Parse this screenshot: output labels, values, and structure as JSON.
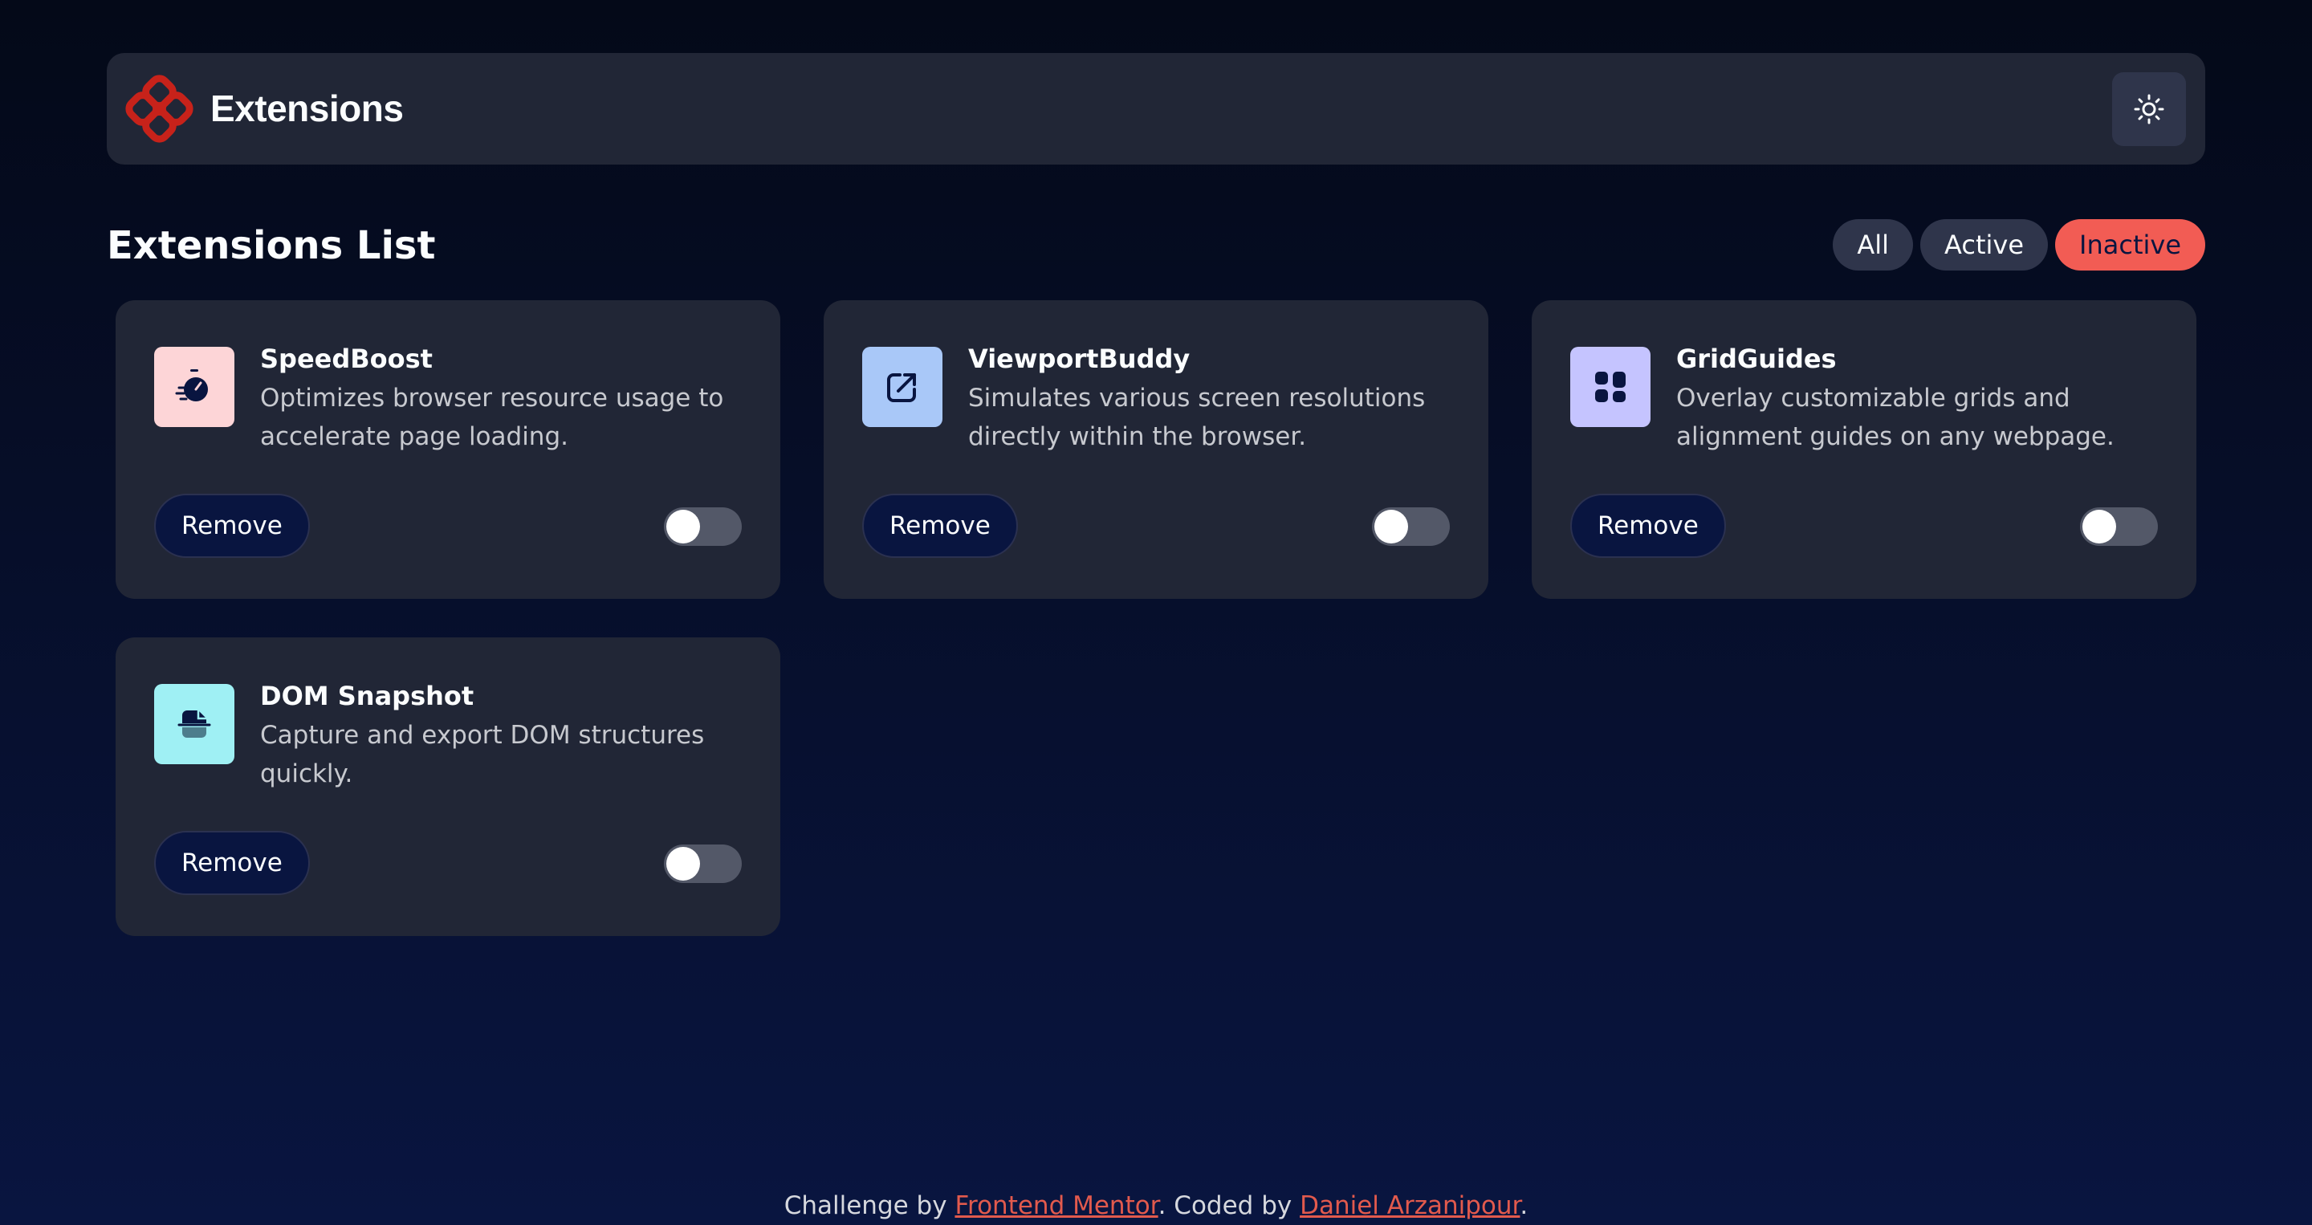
{
  "header": {
    "title": "Extensions",
    "logo_icon": "logo-icon",
    "theme_toggle_icon": "sun-icon"
  },
  "list": {
    "title": "Extensions List",
    "filters": [
      {
        "label": "All",
        "selected": false
      },
      {
        "label": "Active",
        "selected": false
      },
      {
        "label": "Inactive",
        "selected": true
      }
    ]
  },
  "extensions": [
    {
      "name": "SpeedBoost",
      "description": "Optimizes browser resource usage to accelerate page loading.",
      "remove_label": "Remove",
      "active": false,
      "icon": "stopwatch-icon",
      "icon_bg": "#fdd5d7"
    },
    {
      "name": "ViewportBuddy",
      "description": "Simulates various screen resolutions directly within the browser.",
      "remove_label": "Remove",
      "active": false,
      "icon": "external-link-icon",
      "icon_bg": "#a9c8f8"
    },
    {
      "name": "GridGuides",
      "description": "Overlay customizable grids and alignment guides on any webpage.",
      "remove_label": "Remove",
      "active": false,
      "icon": "grid-icon",
      "icon_bg": "#c5c4ff"
    },
    {
      "name": "DOM Snapshot",
      "description": "Capture and export DOM structures quickly.",
      "remove_label": "Remove",
      "active": false,
      "icon": "document-snapshot-icon",
      "icon_bg": "#9ff0f4"
    }
  ],
  "footer": {
    "prefix": "Challenge by ",
    "link1": "Frontend Mentor",
    "middle": ". Coded by ",
    "link2": "Daniel Arzanipour",
    "suffix": "."
  },
  "colors": {
    "accent": "#f25c54",
    "card_bg": "#212636",
    "page_bg_top": "#040918",
    "page_bg_bottom": "#091540",
    "toggle_off": "#535868"
  }
}
